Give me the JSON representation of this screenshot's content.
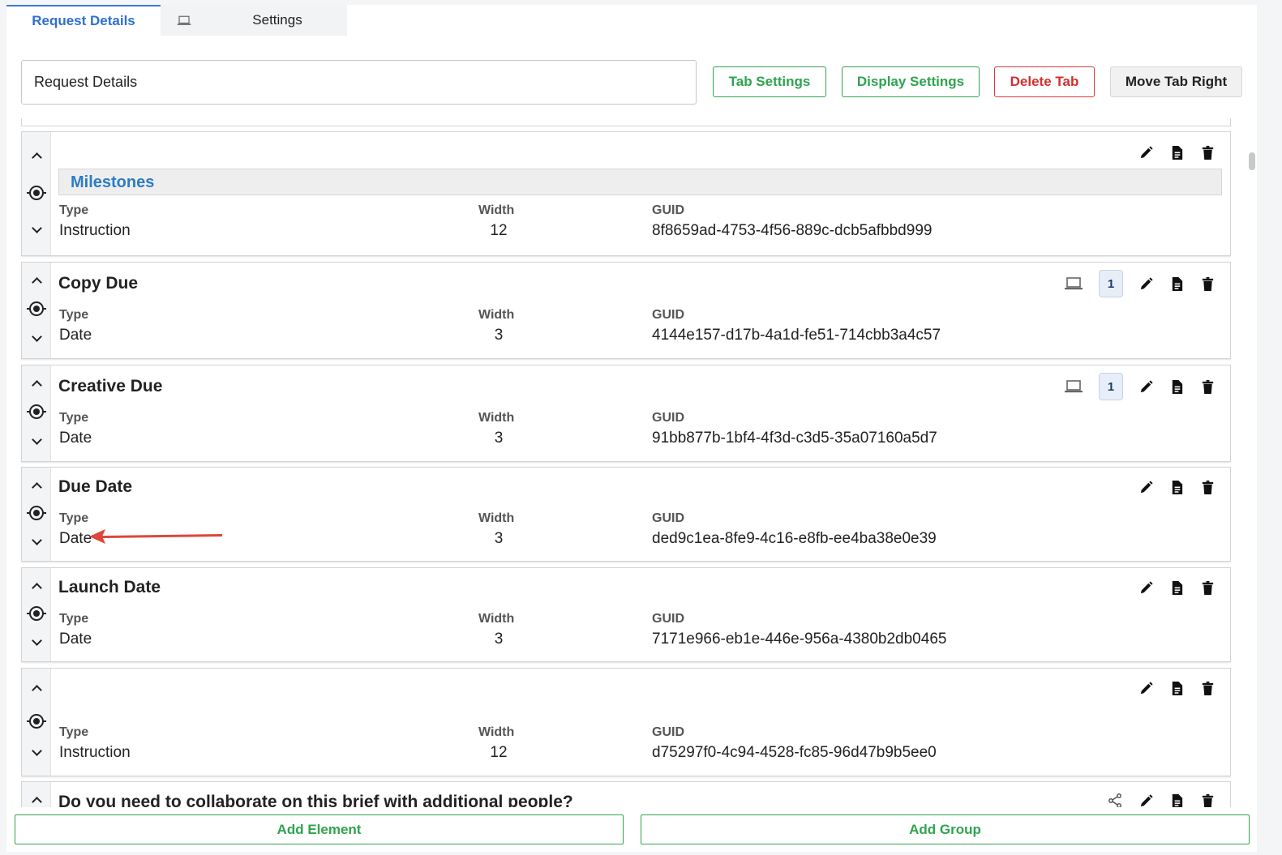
{
  "tabs": [
    {
      "label": "Request Details",
      "active": true
    },
    {
      "label": "",
      "icon": "laptop-icon"
    },
    {
      "label": "Settings"
    }
  ],
  "header": {
    "tab_name_value": "Request Details",
    "buttons": {
      "tab_settings": "Tab Settings",
      "display_settings": "Display Settings",
      "delete_tab": "Delete Tab",
      "move_tab_right": "Move Tab Right"
    }
  },
  "column_labels": {
    "type": "Type",
    "width": "Width",
    "guid": "GUID"
  },
  "elements": [
    {
      "group_title": "Milestones",
      "type": "Instruction",
      "width": "12",
      "guid": "8f8659ad-4753-4f56-889c-dcb5afbbd999"
    },
    {
      "title": "Copy Due",
      "type": "Date",
      "width": "3",
      "guid": "4144e157-d17b-4a1d-fe51-714cbb3a4c57",
      "display_badge": "1"
    },
    {
      "title": "Creative Due",
      "type": "Date",
      "width": "3",
      "guid": "91bb877b-1bf4-4f3d-c3d5-35a07160a5d7",
      "display_badge": "1"
    },
    {
      "title": "Due Date",
      "type": "Date",
      "width": "3",
      "guid": "ded9c1ea-8fe9-4c16-e8fb-ee4ba38e0e39"
    },
    {
      "title": "Launch Date",
      "type": "Date",
      "width": "3",
      "guid": "7171e966-eb1e-446e-956a-4380b2db0465"
    },
    {
      "title": "",
      "type": "Instruction",
      "width": "12",
      "guid": "d75297f0-4c94-4528-fc85-96d47b9b5ee0"
    },
    {
      "title": "Do you need to collaborate on this brief with additional people?"
    }
  ],
  "footer": {
    "add_element": "Add Element",
    "add_group": "Add Group"
  },
  "colors": {
    "accent_blue": "#2f6fd3",
    "green": "#2ea44f",
    "red": "#d32f2f",
    "annotation_arrow": "#e0453a"
  }
}
